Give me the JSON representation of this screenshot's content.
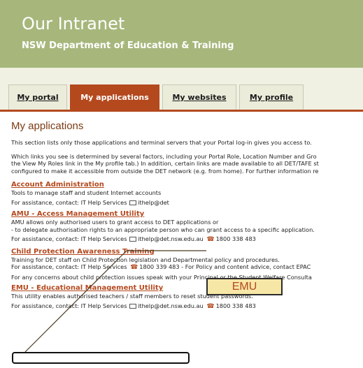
{
  "header": {
    "title": "Our Intranet",
    "subtitle": "NSW Department of Education & Training"
  },
  "tabs": [
    {
      "label": "My portal",
      "active": false
    },
    {
      "label": "My applications",
      "active": true
    },
    {
      "label": "My websites",
      "active": false
    },
    {
      "label": "My profile",
      "active": false
    }
  ],
  "page": {
    "heading": "My applications",
    "intro": "This section lists only those applications and terminal servers that your Portal log-in gives you access to.",
    "para2": [
      "Which links you see is determined by several factors, including your Portal Role, Location Number and Gro",
      "the View My Roles link in the My profile tab.) In addition, certain links are made available to all DET/TAFE st",
      "configured to make it accessible from outside the DET network (e.g. from home). For further information re"
    ]
  },
  "apps": [
    {
      "title": "Account Administration",
      "lines": [
        "Tools to manage staff and student Internet accounts"
      ],
      "assist": "For assistance, contact: IT Help Services",
      "email": "ithelp@det"
    },
    {
      "title": "AMU - Access Management Utility",
      "lines": [
        "AMU allows only authorised users to grant access to DET applications or",
        "- to delegate authorisation rights to an appropriate person who can grant access to a specific application."
      ],
      "assist": "For assistance, contact: IT Help Services",
      "email": "ithelp@det.nsw.edu.au",
      "phone": "1800 338 483"
    },
    {
      "title": "Child Protection Awareness Training",
      "lines": [
        "Training for DET staff on Child Protection legislation and Departmental policy and procedures.",
        "For assistance, contact: IT Help Services",
        "For any concerns about child protection issues speak with your Principal or the Student Welfare Consulta"
      ],
      "phone": "1800 339 483",
      "phone_after": "- For Policy and content advice, contact EPAC"
    },
    {
      "title": "EMU - Educational Management Utility",
      "lines": [
        "This utility enables authorised teachers / staff members to reset student passwords."
      ],
      "assist": "For assistance, contact: IT Help Services",
      "email": "ithelp@det.nsw.edu.au",
      "phone": "1800 338 483"
    }
  ],
  "callout": {
    "label": "EMU"
  },
  "colors": {
    "header": "#a7b77c",
    "accent": "#b4491e",
    "callout_fill": "#f7e7a7"
  }
}
